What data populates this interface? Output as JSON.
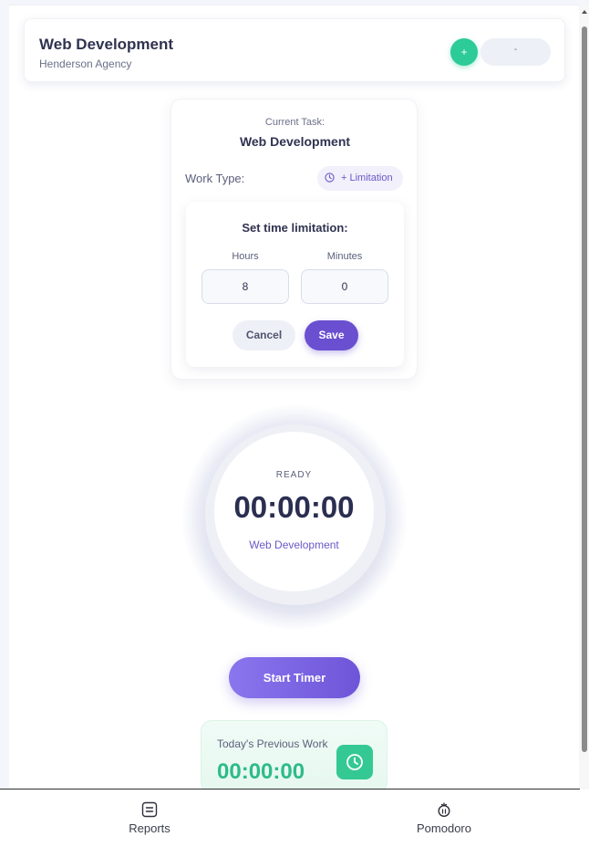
{
  "header": {
    "title": "Web Development",
    "subtitle": "Henderson Agency",
    "add_button_label": "+",
    "pill_button_label": "-"
  },
  "task_card": {
    "current_task_label": "Current Task:",
    "current_task_name": "Web Development",
    "work_type_label": "Work Type:",
    "limitation_button_label": "+ Limitation",
    "limitation_icon": "clock-icon"
  },
  "limit_panel": {
    "title": "Set time limitation:",
    "hours_label": "Hours",
    "hours_value": "8",
    "minutes_label": "Minutes",
    "minutes_value": "0",
    "cancel_label": "Cancel",
    "save_label": "Save"
  },
  "timer": {
    "status": "READY",
    "time": "00:00:00",
    "task": "Web Development"
  },
  "start_button_label": "Start Timer",
  "previous_work": {
    "label": "Today's Previous Work",
    "time": "00:00:00",
    "icon": "clock-icon"
  },
  "bottom_nav": {
    "items": [
      {
        "label": "Reports",
        "icon": "reports-icon"
      },
      {
        "label": "Pomodoro",
        "icon": "pomodoro-icon"
      }
    ]
  },
  "colors": {
    "accent_purple": "#6a4fd0",
    "accent_green": "#2ccb97",
    "title_dark": "#2f3350"
  }
}
